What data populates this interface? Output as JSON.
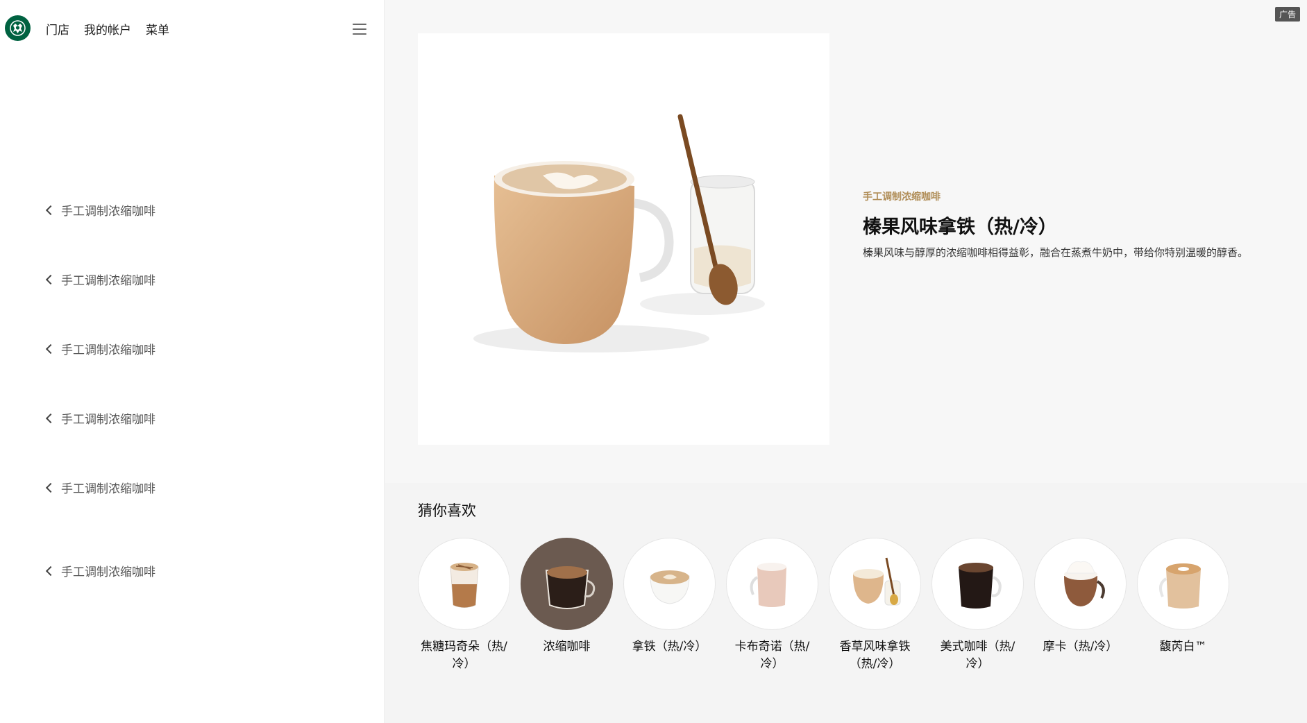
{
  "header": {
    "logo": "starbucks-siren-logo",
    "nav": [
      "门店",
      "我的帐户",
      "菜单"
    ],
    "menu_icon": "hamburger-icon"
  },
  "sidebar": {
    "breadcrumbs": [
      "手工调制浓缩咖啡",
      "手工调制浓缩咖啡",
      "手工调制浓缩咖啡",
      "手工调制浓缩咖啡",
      "手工调制浓缩咖啡",
      "手工调制浓缩咖啡"
    ]
  },
  "ad_badge": "广告",
  "product": {
    "category": "手工调制浓缩咖啡",
    "title": "榛果风味拿铁（热/冷）",
    "description": "榛果风味与醇厚的浓缩咖啡相得益彰，融合在蒸煮牛奶中，带给你特别温暖的醇香。"
  },
  "recommend": {
    "title": "猜你喜欢",
    "items": [
      {
        "name": "焦糖玛奇朵（热/冷）"
      },
      {
        "name": "浓缩咖啡"
      },
      {
        "name": "拿铁（热/冷）"
      },
      {
        "name": "卡布奇诺（热/冷）"
      },
      {
        "name": "香草风味拿铁（热/冷）"
      },
      {
        "name": "美式咖啡（热/冷）"
      },
      {
        "name": "摩卡（热/冷）"
      },
      {
        "name": "馥芮白™"
      }
    ]
  },
  "colors": {
    "brand_green": "#006241",
    "category_gold": "#b08d57"
  }
}
